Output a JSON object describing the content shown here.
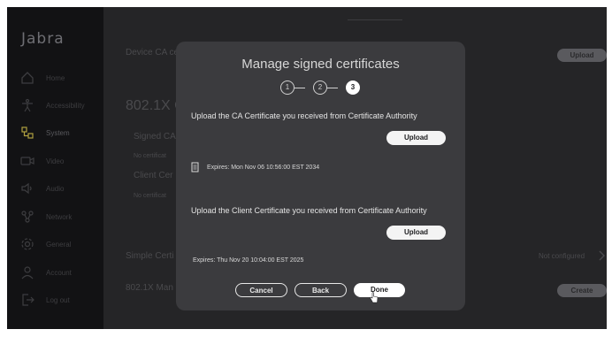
{
  "app": {
    "logo": "Jabra"
  },
  "sidebar": {
    "items": [
      {
        "label": "Home",
        "icon": "home-icon"
      },
      {
        "label": "Accessibility",
        "icon": "accessibility-icon"
      },
      {
        "label": "System",
        "icon": "system-icon",
        "active": true
      },
      {
        "label": "Video",
        "icon": "video-icon"
      },
      {
        "label": "Audio",
        "icon": "audio-icon"
      },
      {
        "label": "Network",
        "icon": "network-icon"
      },
      {
        "label": "General",
        "icon": "gear-icon"
      },
      {
        "label": "Account",
        "icon": "account-icon"
      },
      {
        "label": "Log out",
        "icon": "logout-icon"
      }
    ]
  },
  "background": {
    "device_ca": "Device CA ce",
    "upload_label": "Upload",
    "section_8021x": "802.1X C",
    "signed_ca": "Signed CA",
    "no_cert_1": "No certificat",
    "client_cert": "Client Cer",
    "no_cert_2": "No certificat",
    "simple_cert": "Simple Certi",
    "not_configured": "Not configured",
    "manager": "802.1X Man",
    "create_label": "Create"
  },
  "modal": {
    "title": "Manage signed certificates",
    "steps": [
      "1",
      "2",
      "3"
    ],
    "current_step": 3,
    "ca_instruction": "Upload the CA Certificate you received from Certificate Authority",
    "ca_upload_label": "Upload",
    "ca_expiry": "Expires: Mon Nov 06 10:56:00 EST 2034",
    "client_instruction": "Upload the Client Certificate you received from Certificate Authority",
    "client_upload_label": "Upload",
    "client_expiry": "Expires: Thu Nov 20 10:04:00 EST 2025",
    "cancel_label": "Cancel",
    "back_label": "Back",
    "done_label": "Done"
  },
  "colors": {
    "accent": "#ffffff",
    "panel": "#3b3b3e",
    "background": "#1c1c1e"
  }
}
